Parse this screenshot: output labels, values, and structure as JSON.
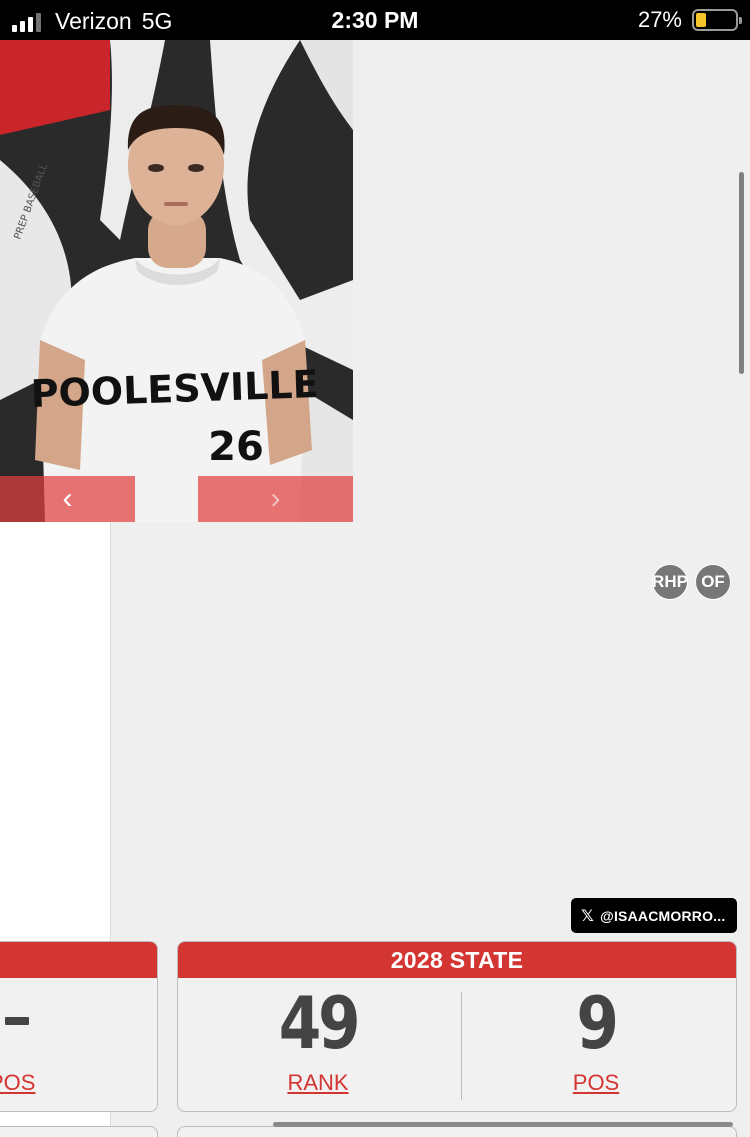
{
  "status_bar": {
    "carrier": "Verizon",
    "network": "5G",
    "time": "2:30 PM",
    "battery_percent": "27%",
    "battery_level": 0.27
  },
  "photo": {
    "shirt_text": "POOLESVILLE",
    "jersey_number": "26",
    "banner_text": "PREP BASEBALL"
  },
  "positions": [
    "RHP",
    "OF"
  ],
  "social": {
    "x_handle": "@ISAACMORRO..."
  },
  "rankings": {
    "left_card": {
      "value": "-",
      "link_label": "POS"
    },
    "state_card": {
      "title": "2028 STATE",
      "rank_value": "49",
      "rank_label": "RANK",
      "pos_value": "9",
      "pos_label": "POS"
    }
  },
  "colors": {
    "accent_red": "#d33533",
    "badge_gray": "#777777"
  }
}
